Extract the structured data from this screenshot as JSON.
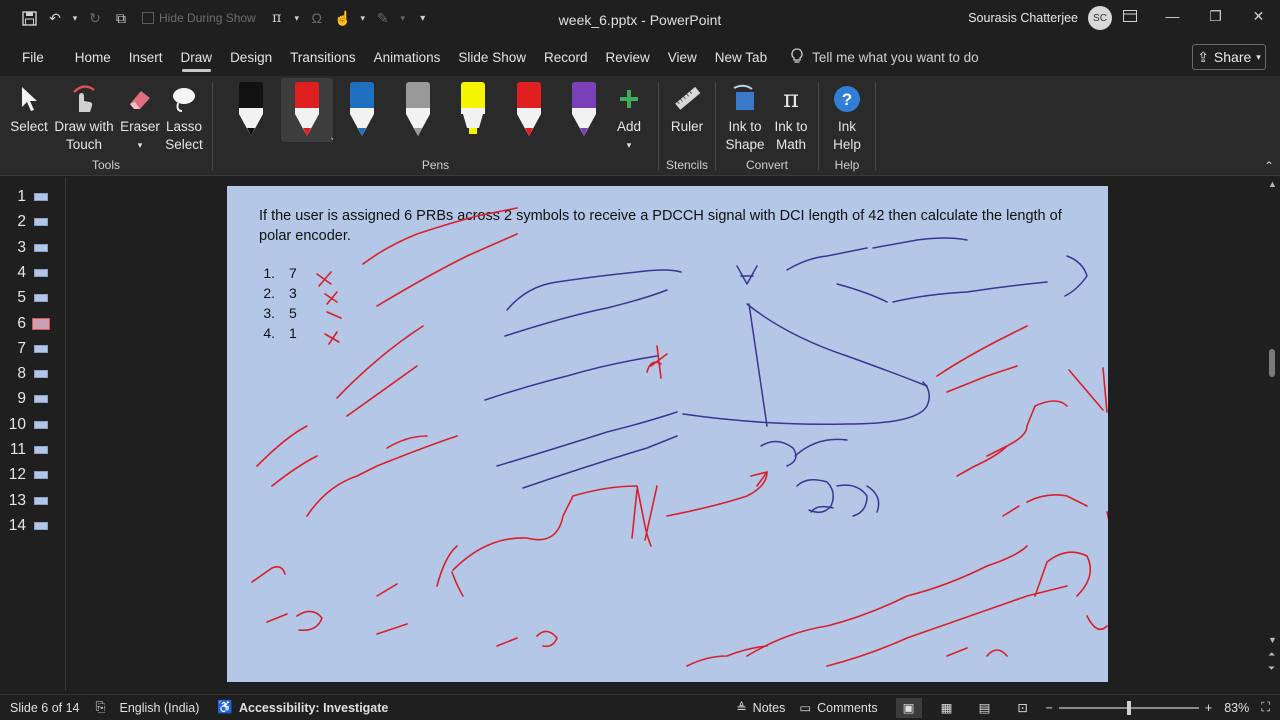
{
  "window": {
    "title": "week_6.pptx  -  PowerPoint",
    "user_name": "Sourasis Chatterjee",
    "user_initials": "SC",
    "hide_during_show": "Hide During Show"
  },
  "tabs": [
    "File",
    "Home",
    "Insert",
    "Draw",
    "Design",
    "Transitions",
    "Animations",
    "Slide Show",
    "Record",
    "Review",
    "View",
    "New Tab"
  ],
  "active_tab": "Draw",
  "tell_me": "Tell me what you want to do",
  "share_label": "Share",
  "ribbon": {
    "tools": {
      "select": "Select",
      "draw_touch_1": "Draw with",
      "draw_touch_2": "Touch",
      "eraser": "Eraser",
      "lasso_1": "Lasso",
      "lasso_2": "Select",
      "label": "Tools"
    },
    "pens": {
      "label": "Pens",
      "add": "Add",
      "colors": [
        "#111111",
        "#e02020",
        "#1e6fbf",
        "#9a9a9a",
        "#f5f500",
        "#e02020",
        "#7b3fb8"
      ]
    },
    "stencils": {
      "ruler": "Ruler",
      "label": "Stencils"
    },
    "convert": {
      "ink_shape_1": "Ink to",
      "ink_shape_2": "Shape",
      "ink_math_1": "Ink to",
      "ink_math_2": "Math",
      "label": "Convert"
    },
    "help": {
      "ink_help_1": "Ink",
      "ink_help_2": "Help",
      "label": "Help"
    }
  },
  "slides": [
    "1",
    "2",
    "3",
    "4",
    "5",
    "6",
    "7",
    "8",
    "9",
    "10",
    "11",
    "12",
    "13",
    "14"
  ],
  "selected_slide": 6,
  "slide": {
    "question_line1": "If the user is assigned 6 PRBs across 2 symbols to receive a PDCCH signal with DCI length of 42 then calculate the length of",
    "question_line2": "polar encoder.",
    "options": [
      {
        "n": "1.",
        "v": "7"
      },
      {
        "n": "2.",
        "v": "3"
      },
      {
        "n": "3.",
        "v": "5"
      },
      {
        "n": "4.",
        "v": "1"
      }
    ],
    "accent_ink_red": "#d8202a",
    "accent_ink_blue": "#3a3590"
  },
  "status": {
    "slide_of": "Slide 6 of 14",
    "language": "English (India)",
    "accessibility": "Accessibility: Investigate",
    "notes": "Notes",
    "comments": "Comments",
    "zoom": "83%"
  }
}
